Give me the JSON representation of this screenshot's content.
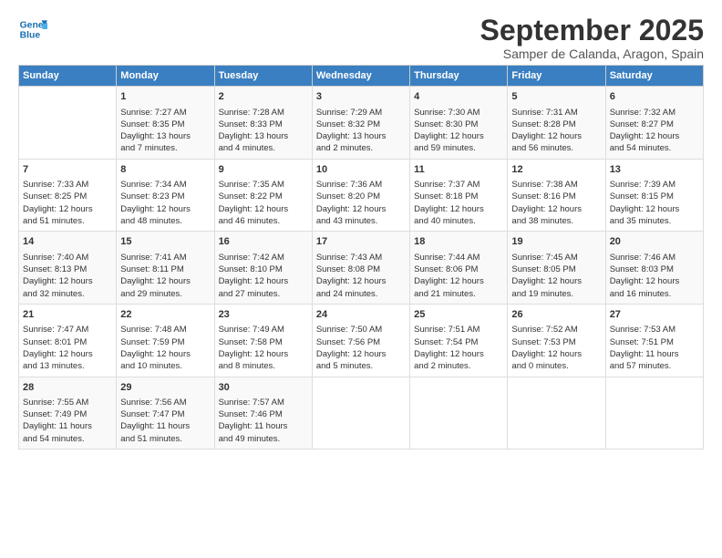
{
  "header": {
    "logo_line1": "General",
    "logo_line2": "Blue",
    "month": "September 2025",
    "location": "Samper de Calanda, Aragon, Spain"
  },
  "days_of_week": [
    "Sunday",
    "Monday",
    "Tuesday",
    "Wednesday",
    "Thursday",
    "Friday",
    "Saturday"
  ],
  "weeks": [
    [
      {
        "day": "",
        "content": ""
      },
      {
        "day": "1",
        "content": "Sunrise: 7:27 AM\nSunset: 8:35 PM\nDaylight: 13 hours\nand 7 minutes."
      },
      {
        "day": "2",
        "content": "Sunrise: 7:28 AM\nSunset: 8:33 PM\nDaylight: 13 hours\nand 4 minutes."
      },
      {
        "day": "3",
        "content": "Sunrise: 7:29 AM\nSunset: 8:32 PM\nDaylight: 13 hours\nand 2 minutes."
      },
      {
        "day": "4",
        "content": "Sunrise: 7:30 AM\nSunset: 8:30 PM\nDaylight: 12 hours\nand 59 minutes."
      },
      {
        "day": "5",
        "content": "Sunrise: 7:31 AM\nSunset: 8:28 PM\nDaylight: 12 hours\nand 56 minutes."
      },
      {
        "day": "6",
        "content": "Sunrise: 7:32 AM\nSunset: 8:27 PM\nDaylight: 12 hours\nand 54 minutes."
      }
    ],
    [
      {
        "day": "7",
        "content": "Sunrise: 7:33 AM\nSunset: 8:25 PM\nDaylight: 12 hours\nand 51 minutes."
      },
      {
        "day": "8",
        "content": "Sunrise: 7:34 AM\nSunset: 8:23 PM\nDaylight: 12 hours\nand 48 minutes."
      },
      {
        "day": "9",
        "content": "Sunrise: 7:35 AM\nSunset: 8:22 PM\nDaylight: 12 hours\nand 46 minutes."
      },
      {
        "day": "10",
        "content": "Sunrise: 7:36 AM\nSunset: 8:20 PM\nDaylight: 12 hours\nand 43 minutes."
      },
      {
        "day": "11",
        "content": "Sunrise: 7:37 AM\nSunset: 8:18 PM\nDaylight: 12 hours\nand 40 minutes."
      },
      {
        "day": "12",
        "content": "Sunrise: 7:38 AM\nSunset: 8:16 PM\nDaylight: 12 hours\nand 38 minutes."
      },
      {
        "day": "13",
        "content": "Sunrise: 7:39 AM\nSunset: 8:15 PM\nDaylight: 12 hours\nand 35 minutes."
      }
    ],
    [
      {
        "day": "14",
        "content": "Sunrise: 7:40 AM\nSunset: 8:13 PM\nDaylight: 12 hours\nand 32 minutes."
      },
      {
        "day": "15",
        "content": "Sunrise: 7:41 AM\nSunset: 8:11 PM\nDaylight: 12 hours\nand 29 minutes."
      },
      {
        "day": "16",
        "content": "Sunrise: 7:42 AM\nSunset: 8:10 PM\nDaylight: 12 hours\nand 27 minutes."
      },
      {
        "day": "17",
        "content": "Sunrise: 7:43 AM\nSunset: 8:08 PM\nDaylight: 12 hours\nand 24 minutes."
      },
      {
        "day": "18",
        "content": "Sunrise: 7:44 AM\nSunset: 8:06 PM\nDaylight: 12 hours\nand 21 minutes."
      },
      {
        "day": "19",
        "content": "Sunrise: 7:45 AM\nSunset: 8:05 PM\nDaylight: 12 hours\nand 19 minutes."
      },
      {
        "day": "20",
        "content": "Sunrise: 7:46 AM\nSunset: 8:03 PM\nDaylight: 12 hours\nand 16 minutes."
      }
    ],
    [
      {
        "day": "21",
        "content": "Sunrise: 7:47 AM\nSunset: 8:01 PM\nDaylight: 12 hours\nand 13 minutes."
      },
      {
        "day": "22",
        "content": "Sunrise: 7:48 AM\nSunset: 7:59 PM\nDaylight: 12 hours\nand 10 minutes."
      },
      {
        "day": "23",
        "content": "Sunrise: 7:49 AM\nSunset: 7:58 PM\nDaylight: 12 hours\nand 8 minutes."
      },
      {
        "day": "24",
        "content": "Sunrise: 7:50 AM\nSunset: 7:56 PM\nDaylight: 12 hours\nand 5 minutes."
      },
      {
        "day": "25",
        "content": "Sunrise: 7:51 AM\nSunset: 7:54 PM\nDaylight: 12 hours\nand 2 minutes."
      },
      {
        "day": "26",
        "content": "Sunrise: 7:52 AM\nSunset: 7:53 PM\nDaylight: 12 hours\nand 0 minutes."
      },
      {
        "day": "27",
        "content": "Sunrise: 7:53 AM\nSunset: 7:51 PM\nDaylight: 11 hours\nand 57 minutes."
      }
    ],
    [
      {
        "day": "28",
        "content": "Sunrise: 7:55 AM\nSunset: 7:49 PM\nDaylight: 11 hours\nand 54 minutes."
      },
      {
        "day": "29",
        "content": "Sunrise: 7:56 AM\nSunset: 7:47 PM\nDaylight: 11 hours\nand 51 minutes."
      },
      {
        "day": "30",
        "content": "Sunrise: 7:57 AM\nSunset: 7:46 PM\nDaylight: 11 hours\nand 49 minutes."
      },
      {
        "day": "",
        "content": ""
      },
      {
        "day": "",
        "content": ""
      },
      {
        "day": "",
        "content": ""
      },
      {
        "day": "",
        "content": ""
      }
    ]
  ]
}
